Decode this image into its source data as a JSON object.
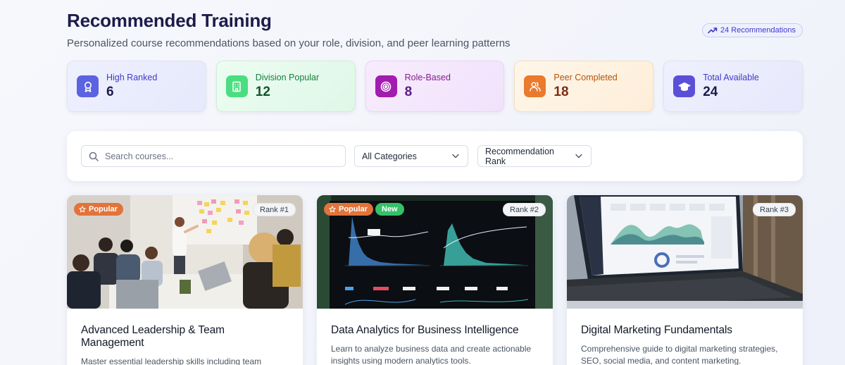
{
  "header": {
    "title": "Recommended Training",
    "subtitle": "Personalized course recommendations based on your role, division, and peer learning patterns",
    "recommendations_badge": "24 Recommendations"
  },
  "stats": [
    {
      "label": "High Ranked",
      "value": "6",
      "icon": "award-icon",
      "color": "#5b63e0"
    },
    {
      "label": "Division Popular",
      "value": "12",
      "icon": "building-icon",
      "color": "#4ade80"
    },
    {
      "label": "Role-Based",
      "value": "8",
      "icon": "target-icon",
      "color": "#a21caf"
    },
    {
      "label": "Peer Completed",
      "value": "18",
      "icon": "users-icon",
      "color": "#ea7a2c"
    },
    {
      "label": "Total Available",
      "value": "24",
      "icon": "graduation-cap-icon",
      "color": "#5b4fd8"
    }
  ],
  "filters": {
    "search_placeholder": "Search courses...",
    "category_selected": "All Categories",
    "sort_selected": "Recommendation Rank"
  },
  "courses": [
    {
      "title": "Advanced Leadership & Team Management",
      "description": "Master essential leadership skills including team dynamics, conflict resolution, and strategic decision-...",
      "rank": "Rank #1",
      "popular_label": "Popular"
    },
    {
      "title": "Data Analytics for Business Intelligence",
      "description": "Learn to analyze business data and create actionable insights using modern analytics tools.",
      "rank": "Rank #2",
      "popular_label": "Popular",
      "new_label": "New"
    },
    {
      "title": "Digital Marketing Fundamentals",
      "description": "Comprehensive guide to digital marketing strategies, SEO, social media, and content marketing.",
      "rank": "Rank #3"
    }
  ],
  "colors": {
    "title": "#1e1b4b",
    "accent": "#4338ca",
    "popular_badge": "#e2733a",
    "new_badge": "#34c167"
  }
}
